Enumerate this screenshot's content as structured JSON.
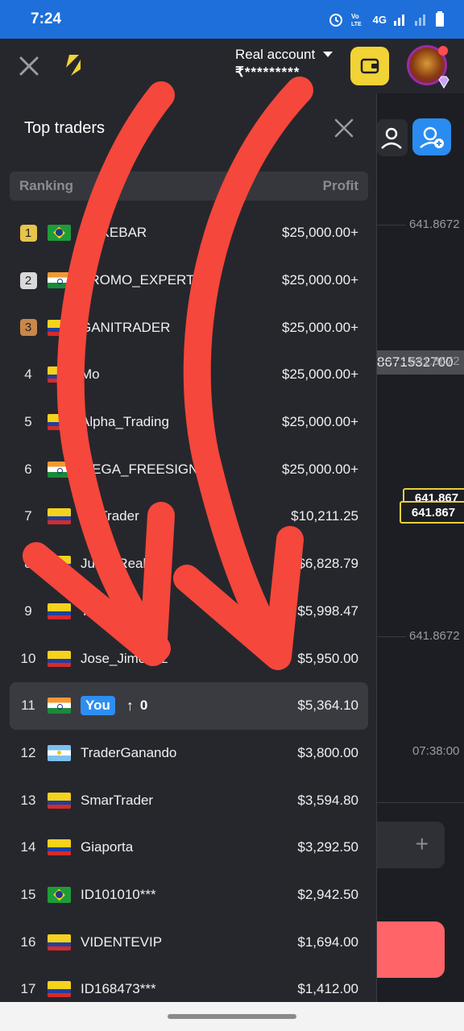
{
  "status_bar": {
    "time": "7:24",
    "network": "4G"
  },
  "app_bar": {
    "account_label": "Real account",
    "balance": "₹*********"
  },
  "chart": {
    "price_levels": [
      "641.8672",
      "641.8672",
      "641.8672"
    ],
    "highlight_value": "8671532700",
    "current_price_back": "641.867",
    "current_price": "641.867",
    "time_label": "07:38:00"
  },
  "panel": {
    "title": "Top traders",
    "header_ranking": "Ranking",
    "header_profit": "Profit",
    "rows": [
      {
        "rank": "1",
        "flag": "br",
        "name": "DUKEBAR",
        "profit": "$25,000.00+"
      },
      {
        "rank": "2",
        "flag": "in",
        "name": "PROMO_EXPERT",
        "profit": "$25,000.00+"
      },
      {
        "rank": "3",
        "flag": "co",
        "name": "GANITRADER",
        "profit": "$25,000.00+"
      },
      {
        "rank": "4",
        "flag": "co",
        "name": "Mo",
        "profit": "$25,000.00+"
      },
      {
        "rank": "5",
        "flag": "co",
        "name": "Alpha_Trading",
        "profit": "$25,000.00+"
      },
      {
        "rank": "6",
        "flag": "in",
        "name": "MEGA_FREESIGNL",
        "profit": "$25,000.00+"
      },
      {
        "rank": "7",
        "flag": "co",
        "name": "VicTrader",
        "profit": "$10,211.25"
      },
      {
        "rank": "8",
        "flag": "co",
        "name": "Juan_Real",
        "profit": "$6,828.79"
      },
      {
        "rank": "9",
        "flag": "co",
        "name": "TraderNobody",
        "profit": "$5,998.47"
      },
      {
        "rank": "10",
        "flag": "co",
        "name": "Jose_Jimenez",
        "profit": "$5,950.00"
      },
      {
        "rank": "11",
        "flag": "in",
        "name": "You",
        "change": "0",
        "profit": "$5,364.10"
      },
      {
        "rank": "12",
        "flag": "ar",
        "name": "TraderGanando",
        "profit": "$3,800.00"
      },
      {
        "rank": "13",
        "flag": "co",
        "name": "SmarTrader",
        "profit": "$3,594.80"
      },
      {
        "rank": "14",
        "flag": "co",
        "name": "Giaporta",
        "profit": "$3,292.50"
      },
      {
        "rank": "15",
        "flag": "br",
        "name": "ID101010***",
        "profit": "$2,942.50"
      },
      {
        "rank": "16",
        "flag": "co",
        "name": "VIDENTEVIP",
        "profit": "$1,694.00"
      },
      {
        "rank": "17",
        "flag": "co",
        "name": "ID168473***",
        "profit": "$1,412.00"
      }
    ]
  },
  "colors": {
    "accent_blue": "#2d8ef2",
    "annotation_red": "#f5473b",
    "gold": "#e8c449",
    "silver": "#d9d9d9",
    "bronze": "#c9874a"
  }
}
